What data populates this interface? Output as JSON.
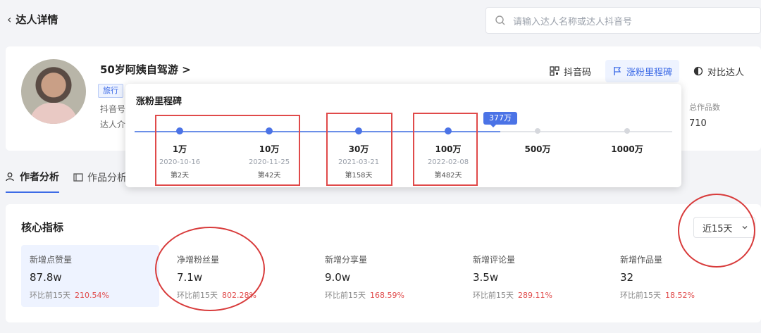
{
  "header": {
    "back_label": "达人详情",
    "search_placeholder": "请输入达人名称或达人抖音号"
  },
  "profile": {
    "name": "50岁阿姨自驾游 >",
    "tag": "旅行",
    "douyin_label": "抖音号",
    "intro_label": "达人介",
    "actions": [
      "抖音码",
      "涨粉里程碑",
      "对比达人"
    ],
    "stat_label": "总作品数",
    "stat_value": "710"
  },
  "tabs": [
    "作者分析",
    "作品分析"
  ],
  "milestone_popover": {
    "title": "涨粉里程碑",
    "current": "377万",
    "current_fraction": 0.68,
    "milestones": [
      {
        "amount": "1万",
        "date": "2020-10-16",
        "day": "第2天",
        "reached": true
      },
      {
        "amount": "10万",
        "date": "2020-11-25",
        "day": "第42天",
        "reached": true
      },
      {
        "amount": "30万",
        "date": "2021-03-21",
        "day": "第158天",
        "reached": true
      },
      {
        "amount": "100万",
        "date": "2022-02-08",
        "day": "第482天",
        "reached": true
      },
      {
        "amount": "500万",
        "date": "",
        "day": "",
        "reached": false
      },
      {
        "amount": "1000万",
        "date": "",
        "day": "",
        "reached": false
      }
    ]
  },
  "core": {
    "title": "核心指标",
    "range": "近15天",
    "metrics": [
      {
        "label": "新增点赞量",
        "value": "87.8w",
        "compare": "环比前15天",
        "pct": "210.54%"
      },
      {
        "label": "净增粉丝量",
        "value": "7.1w",
        "compare": "环比前15天",
        "pct": "802.28%"
      },
      {
        "label": "新增分享量",
        "value": "9.0w",
        "compare": "环比前15天",
        "pct": "168.59%"
      },
      {
        "label": "新增评论量",
        "value": "3.5w",
        "compare": "环比前15天",
        "pct": "289.11%"
      },
      {
        "label": "新增作品量",
        "value": "32",
        "compare": "环比前15天",
        "pct": "18.52%"
      }
    ]
  },
  "colors": {
    "accent": "#3d6be6",
    "highlight": "#e04a4a"
  },
  "icons": [
    "search-icon",
    "qrcode-icon",
    "flag-icon",
    "compare-icon",
    "user-icon",
    "video-icon",
    "chevron-down-icon"
  ]
}
